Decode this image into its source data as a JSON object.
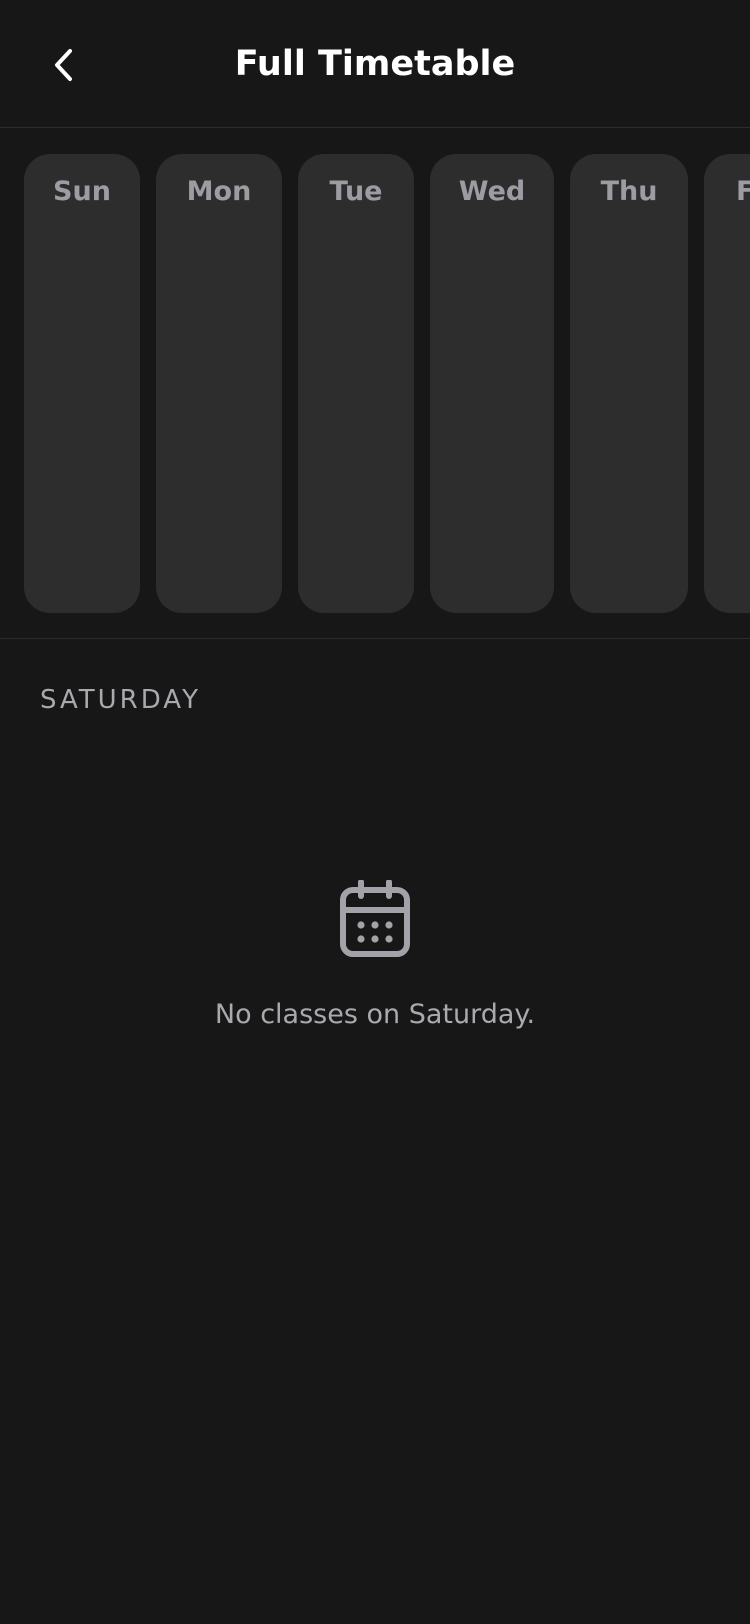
{
  "header": {
    "title": "Full Timetable",
    "back_icon": "chevron-left-icon"
  },
  "days": [
    {
      "label": "Sun"
    },
    {
      "label": "Mon"
    },
    {
      "label": "Tue"
    },
    {
      "label": "Wed"
    },
    {
      "label": "Thu"
    },
    {
      "label": "F"
    }
  ],
  "selected_day": {
    "section_label": "SATURDAY",
    "empty_icon": "calendar-icon",
    "empty_message": "No classes on Saturday."
  },
  "colors": {
    "background": "#171717",
    "card": "#2d2d2d",
    "muted_text": "#a9a9ae",
    "day_text": "#9c9ca3"
  }
}
